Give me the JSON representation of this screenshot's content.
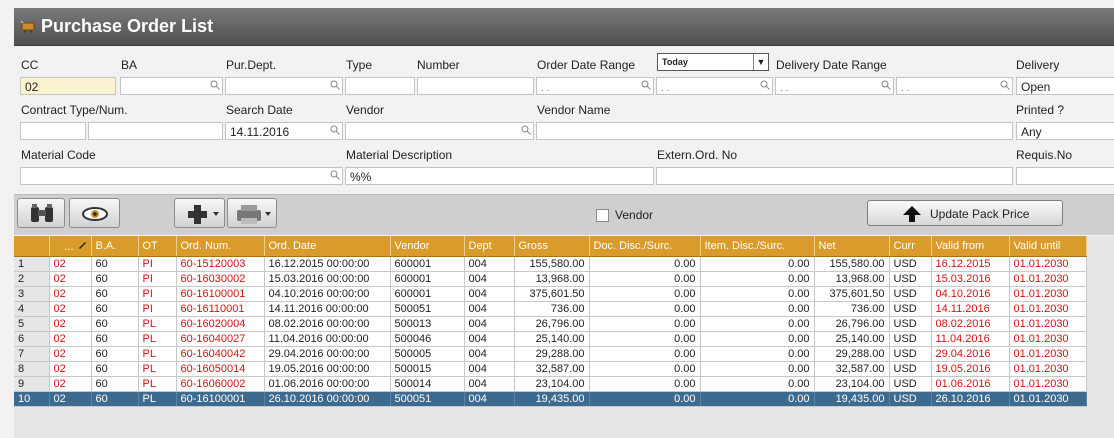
{
  "window": {
    "title": "Purchase Order List",
    "title_icon": "cart-icon"
  },
  "filters": {
    "cc": {
      "label": "CC",
      "value": "02"
    },
    "ba": {
      "label": "BA",
      "value": ""
    },
    "pur_dept": {
      "label": "Pur.Dept.",
      "value": ""
    },
    "type": {
      "label": "Type",
      "value": ""
    },
    "number": {
      "label": "Number",
      "value": ""
    },
    "order_date_range": {
      "label": "Order Date Range",
      "preset": "Today",
      "from": ". .",
      "to": ". ."
    },
    "delivery_date_range": {
      "label": "Delivery Date Range",
      "from": ". .",
      "to": ". ."
    },
    "delivery": {
      "label": "Delivery",
      "value": "Open"
    },
    "contract": {
      "label": "Contract Type/Num.",
      "type": "",
      "num": ""
    },
    "search_date": {
      "label": "Search Date",
      "value": "14.11.2016"
    },
    "vendor": {
      "label": "Vendor",
      "value": ""
    },
    "vendor_name": {
      "label": "Vendor Name",
      "value": ""
    },
    "printed": {
      "label": "Printed ?",
      "value": "Any"
    },
    "material_code": {
      "label": "Material Code",
      "value": ""
    },
    "material_description": {
      "label": "Material Description",
      "value": "%%"
    },
    "extern_ord_no": {
      "label": "Extern.Ord. No",
      "value": ""
    },
    "requis_no": {
      "label": "Requis.No",
      "value": ""
    }
  },
  "toolbar": {
    "buttons": [
      "binoculars-icon",
      "eye-icon",
      "add-icon",
      "printer-icon"
    ],
    "vendor_checkbox_label": "Vendor",
    "vendor_checked": false,
    "update_pack_price_label": "Update Pack Price",
    "update_icon": "arrow-up-icon"
  },
  "grid": {
    "header_color": "#d99b2a",
    "selected_row_color": "#3d6b90",
    "columns": [
      "",
      "...",
      "B.A.",
      "OT",
      "Ord. Num.",
      "Ord. Date",
      "Vendor",
      "Dept",
      "Gross",
      "Doc. Disc./Surc.",
      "Item. Disc./Surc.",
      "Net",
      "Curr",
      "Valid from",
      "Valid until"
    ],
    "rows": [
      [
        "1",
        "02",
        "60",
        "PI",
        "60-15120003",
        "16.12.2015 00:00:00",
        "600001",
        "004",
        "155,580.00",
        "0.00",
        "0.00",
        "155,580.00",
        "USD",
        "16.12.2015",
        "01.01.2030"
      ],
      [
        "2",
        "02",
        "60",
        "PI",
        "60-16030002",
        "15.03.2016 00:00:00",
        "600001",
        "004",
        "13,968.00",
        "0.00",
        "0.00",
        "13,968.00",
        "USD",
        "15.03.2016",
        "01.01.2030"
      ],
      [
        "3",
        "02",
        "60",
        "PI",
        "60-16100001",
        "04.10.2016 00:00:00",
        "600001",
        "004",
        "375,601.50",
        "0.00",
        "0.00",
        "375,601.50",
        "USD",
        "04.10.2016",
        "01.01.2030"
      ],
      [
        "4",
        "02",
        "60",
        "PI",
        "60-16110001",
        "14.11.2016 00:00:00",
        "500051",
        "004",
        "736.00",
        "0.00",
        "0.00",
        "736.00",
        "USD",
        "14.11.2016",
        "01.01.2030"
      ],
      [
        "5",
        "02",
        "60",
        "PL",
        "60-16020004",
        "08.02.2016 00:00:00",
        "500013",
        "004",
        "26,796.00",
        "0.00",
        "0.00",
        "26,796.00",
        "USD",
        "08.02.2016",
        "01.01.2030"
      ],
      [
        "6",
        "02",
        "60",
        "PL",
        "60-16040027",
        "11.04.2016 00:00:00",
        "500046",
        "004",
        "25,140.00",
        "0.00",
        "0.00",
        "25,140.00",
        "USD",
        "11.04.2016",
        "01.01.2030"
      ],
      [
        "7",
        "02",
        "60",
        "PL",
        "60-16040042",
        "29.04.2016 00:00:00",
        "500005",
        "004",
        "29,288.00",
        "0.00",
        "0.00",
        "29,288.00",
        "USD",
        "29.04.2016",
        "01.01.2030"
      ],
      [
        "8",
        "02",
        "60",
        "PL",
        "60-16050014",
        "19.05.2016 00:00:00",
        "500015",
        "004",
        "32,587.00",
        "0.00",
        "0.00",
        "32,587.00",
        "USD",
        "19.05.2016",
        "01.01.2030"
      ],
      [
        "9",
        "02",
        "60",
        "PL",
        "60-16060002",
        "01.06.2016 00:00:00",
        "500014",
        "004",
        "23,104.00",
        "0.00",
        "0.00",
        "23,104.00",
        "USD",
        "01.06.2016",
        "01.01.2030"
      ],
      [
        "10",
        "02",
        "60",
        "PL",
        "60-16100001",
        "26.10.2016 00:00:00",
        "500051",
        "004",
        "19,435.00",
        "0.00",
        "0.00",
        "19,435.00",
        "USD",
        "26.10.2016",
        "01.01.2030"
      ]
    ],
    "selected_row": 9
  }
}
